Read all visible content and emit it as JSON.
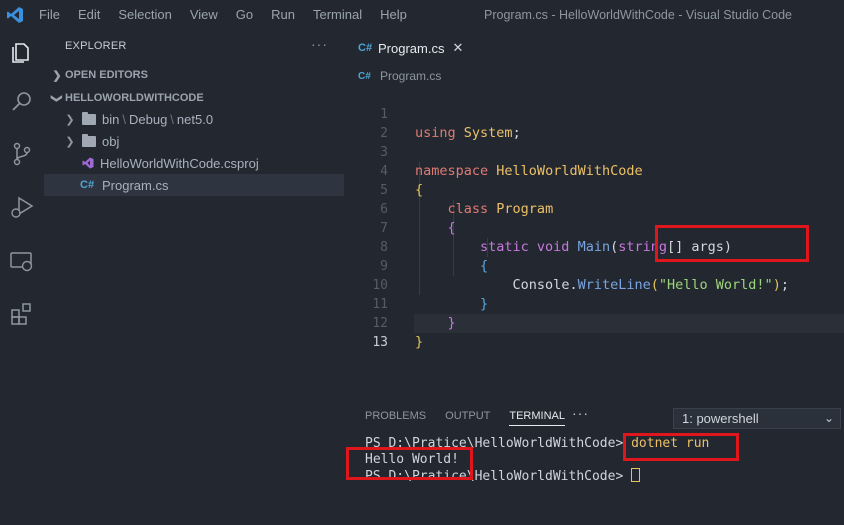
{
  "window": {
    "title": "Program.cs - HelloWorldWithCode - Visual Studio Code",
    "menu": [
      "File",
      "Edit",
      "Selection",
      "View",
      "Go",
      "Run",
      "Terminal",
      "Help"
    ]
  },
  "activity_bar": [
    "explorer-icon",
    "search-icon",
    "source-control-icon",
    "run-debug-icon",
    "remote-explorer-icon",
    "extensions-icon"
  ],
  "sidebar": {
    "title": "EXPLORER",
    "more": "···",
    "open_editors": "OPEN EDITORS",
    "project": "HELLOWORLDWITHCODE",
    "tree": {
      "bin": "bin",
      "debug": "Debug",
      "net": "net5.0",
      "obj": "obj",
      "csproj": "HelloWorldWithCode.csproj",
      "program": "Program.cs"
    }
  },
  "editor": {
    "tab_label": "Program.cs",
    "tab_icon": "C#",
    "breadcrumb": "Program.cs",
    "lines": [
      "1",
      "2",
      "3",
      "4",
      "5",
      "6",
      "7",
      "8",
      "9",
      "10",
      "11",
      "12",
      "13"
    ],
    "code": {
      "using_kw": "using",
      "system": "System",
      "namespace_kw": "namespace",
      "namespace_name": "HelloWorldWithCode",
      "class_kw": "class",
      "class_name": "Program",
      "static_kw": "static void",
      "main_fn": "Main",
      "string_kw": "string",
      "args": "[] args",
      "console": "Console",
      "writeline": "WriteLine",
      "hello_str": "\"Hello World!\""
    }
  },
  "panel": {
    "tabs": [
      "PROBLEMS",
      "OUTPUT",
      "TERMINAL"
    ],
    "active_tab": "TERMINAL",
    "more": "···",
    "terminal_select": "1: powershell",
    "terminal": {
      "prompt1": "PS D:\\Pratice\\HelloWorldWithCode> ",
      "command": "dotnet run",
      "output": "Hello World!",
      "prompt2": "PS D:\\Pratice\\HelloWorldWithCode> "
    }
  },
  "colors": {
    "highlight_box": "#e0161d",
    "background": "#232830",
    "accent_blue": "#3c8fdd"
  }
}
